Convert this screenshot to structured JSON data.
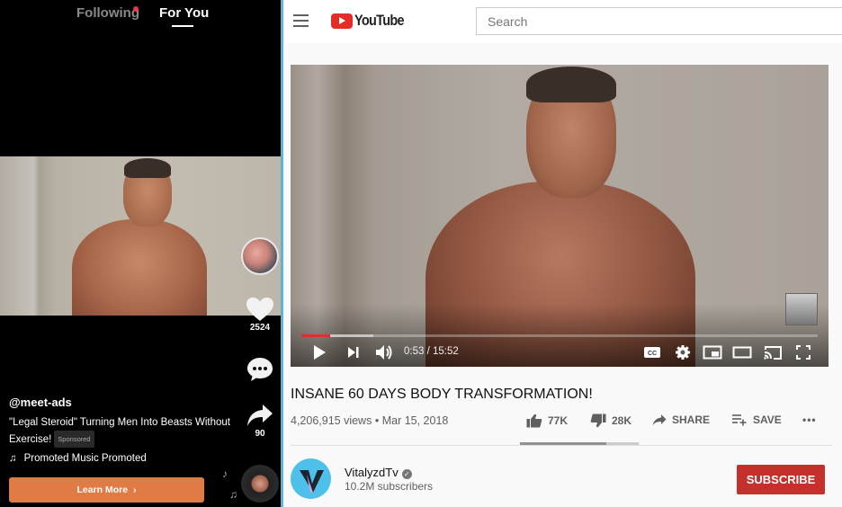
{
  "tiktok": {
    "tabs": [
      {
        "label": "Following",
        "has_notification": true,
        "active": false
      },
      {
        "label": "For You",
        "active": true
      }
    ],
    "likes": "2524",
    "shares": "90",
    "handle": "@meet-ads",
    "caption": "\"Legal Steroid\" Turning Men Into Beasts Without Exercise!",
    "sponsored_label": "Sponsored",
    "music": "Promoted Music   Promoted",
    "cta_label": "Learn More",
    "icons": {
      "like": "heart-icon",
      "comment": "comment-icon",
      "share": "share-arrow-icon",
      "music": "music-note-icon",
      "cta": "chevron-right-icon"
    },
    "colors": {
      "cta": "#e17b45",
      "notification_dot": "#f0344f"
    }
  },
  "youtube": {
    "header": {
      "logo_text": "YouTube",
      "search_placeholder": "Search"
    },
    "player": {
      "current_time": "0:53",
      "duration": "15:52",
      "time_display": "0:53 / 15:52",
      "played_fraction": 0.056,
      "buffered_fraction": 0.14,
      "controls": [
        "play-icon",
        "next-icon",
        "volume-icon",
        "captions-icon",
        "settings-icon",
        "miniplayer-icon",
        "theater-icon",
        "cast-icon",
        "fullscreen-icon"
      ]
    },
    "video": {
      "title": "INSANE 60 DAYS BODY TRANSFORMATION!",
      "views": "4,206,915 views",
      "separator": "•",
      "date": "Mar 15, 2018",
      "likes": "77K",
      "dislikes": "28K",
      "like_fraction": 0.73,
      "share_label": "SHARE",
      "save_label": "SAVE",
      "more_label": "•••"
    },
    "channel": {
      "name": "VitalyzdTv",
      "verified_mark": "✓",
      "subscribers": "10.2M subscribers",
      "subscribe_label": "SUBSCRIBE"
    },
    "colors": {
      "brand_red": "#e52d27",
      "subscribe": "#c4302b"
    }
  }
}
